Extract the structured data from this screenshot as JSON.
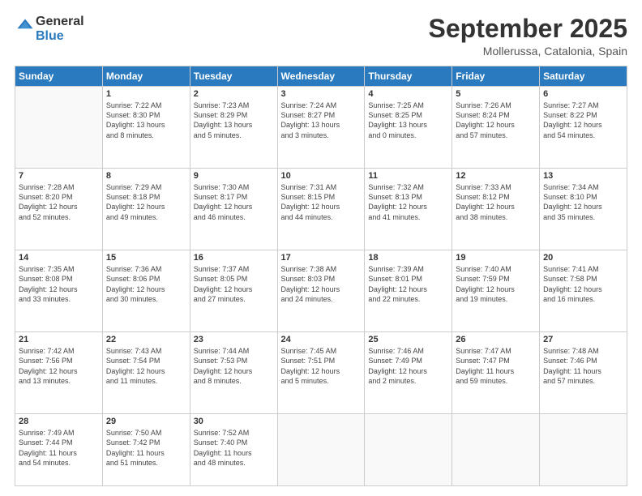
{
  "header": {
    "logo_line1": "General",
    "logo_line2": "Blue",
    "month": "September 2025",
    "location": "Mollerussa, Catalonia, Spain"
  },
  "weekdays": [
    "Sunday",
    "Monday",
    "Tuesday",
    "Wednesday",
    "Thursday",
    "Friday",
    "Saturday"
  ],
  "weeks": [
    [
      {
        "day": "",
        "info": ""
      },
      {
        "day": "1",
        "info": "Sunrise: 7:22 AM\nSunset: 8:30 PM\nDaylight: 13 hours\nand 8 minutes."
      },
      {
        "day": "2",
        "info": "Sunrise: 7:23 AM\nSunset: 8:29 PM\nDaylight: 13 hours\nand 5 minutes."
      },
      {
        "day": "3",
        "info": "Sunrise: 7:24 AM\nSunset: 8:27 PM\nDaylight: 13 hours\nand 3 minutes."
      },
      {
        "day": "4",
        "info": "Sunrise: 7:25 AM\nSunset: 8:25 PM\nDaylight: 13 hours\nand 0 minutes."
      },
      {
        "day": "5",
        "info": "Sunrise: 7:26 AM\nSunset: 8:24 PM\nDaylight: 12 hours\nand 57 minutes."
      },
      {
        "day": "6",
        "info": "Sunrise: 7:27 AM\nSunset: 8:22 PM\nDaylight: 12 hours\nand 54 minutes."
      }
    ],
    [
      {
        "day": "7",
        "info": "Sunrise: 7:28 AM\nSunset: 8:20 PM\nDaylight: 12 hours\nand 52 minutes."
      },
      {
        "day": "8",
        "info": "Sunrise: 7:29 AM\nSunset: 8:18 PM\nDaylight: 12 hours\nand 49 minutes."
      },
      {
        "day": "9",
        "info": "Sunrise: 7:30 AM\nSunset: 8:17 PM\nDaylight: 12 hours\nand 46 minutes."
      },
      {
        "day": "10",
        "info": "Sunrise: 7:31 AM\nSunset: 8:15 PM\nDaylight: 12 hours\nand 44 minutes."
      },
      {
        "day": "11",
        "info": "Sunrise: 7:32 AM\nSunset: 8:13 PM\nDaylight: 12 hours\nand 41 minutes."
      },
      {
        "day": "12",
        "info": "Sunrise: 7:33 AM\nSunset: 8:12 PM\nDaylight: 12 hours\nand 38 minutes."
      },
      {
        "day": "13",
        "info": "Sunrise: 7:34 AM\nSunset: 8:10 PM\nDaylight: 12 hours\nand 35 minutes."
      }
    ],
    [
      {
        "day": "14",
        "info": "Sunrise: 7:35 AM\nSunset: 8:08 PM\nDaylight: 12 hours\nand 33 minutes."
      },
      {
        "day": "15",
        "info": "Sunrise: 7:36 AM\nSunset: 8:06 PM\nDaylight: 12 hours\nand 30 minutes."
      },
      {
        "day": "16",
        "info": "Sunrise: 7:37 AM\nSunset: 8:05 PM\nDaylight: 12 hours\nand 27 minutes."
      },
      {
        "day": "17",
        "info": "Sunrise: 7:38 AM\nSunset: 8:03 PM\nDaylight: 12 hours\nand 24 minutes."
      },
      {
        "day": "18",
        "info": "Sunrise: 7:39 AM\nSunset: 8:01 PM\nDaylight: 12 hours\nand 22 minutes."
      },
      {
        "day": "19",
        "info": "Sunrise: 7:40 AM\nSunset: 7:59 PM\nDaylight: 12 hours\nand 19 minutes."
      },
      {
        "day": "20",
        "info": "Sunrise: 7:41 AM\nSunset: 7:58 PM\nDaylight: 12 hours\nand 16 minutes."
      }
    ],
    [
      {
        "day": "21",
        "info": "Sunrise: 7:42 AM\nSunset: 7:56 PM\nDaylight: 12 hours\nand 13 minutes."
      },
      {
        "day": "22",
        "info": "Sunrise: 7:43 AM\nSunset: 7:54 PM\nDaylight: 12 hours\nand 11 minutes."
      },
      {
        "day": "23",
        "info": "Sunrise: 7:44 AM\nSunset: 7:53 PM\nDaylight: 12 hours\nand 8 minutes."
      },
      {
        "day": "24",
        "info": "Sunrise: 7:45 AM\nSunset: 7:51 PM\nDaylight: 12 hours\nand 5 minutes."
      },
      {
        "day": "25",
        "info": "Sunrise: 7:46 AM\nSunset: 7:49 PM\nDaylight: 12 hours\nand 2 minutes."
      },
      {
        "day": "26",
        "info": "Sunrise: 7:47 AM\nSunset: 7:47 PM\nDaylight: 11 hours\nand 59 minutes."
      },
      {
        "day": "27",
        "info": "Sunrise: 7:48 AM\nSunset: 7:46 PM\nDaylight: 11 hours\nand 57 minutes."
      }
    ],
    [
      {
        "day": "28",
        "info": "Sunrise: 7:49 AM\nSunset: 7:44 PM\nDaylight: 11 hours\nand 54 minutes."
      },
      {
        "day": "29",
        "info": "Sunrise: 7:50 AM\nSunset: 7:42 PM\nDaylight: 11 hours\nand 51 minutes."
      },
      {
        "day": "30",
        "info": "Sunrise: 7:52 AM\nSunset: 7:40 PM\nDaylight: 11 hours\nand 48 minutes."
      },
      {
        "day": "",
        "info": ""
      },
      {
        "day": "",
        "info": ""
      },
      {
        "day": "",
        "info": ""
      },
      {
        "day": "",
        "info": ""
      }
    ]
  ]
}
